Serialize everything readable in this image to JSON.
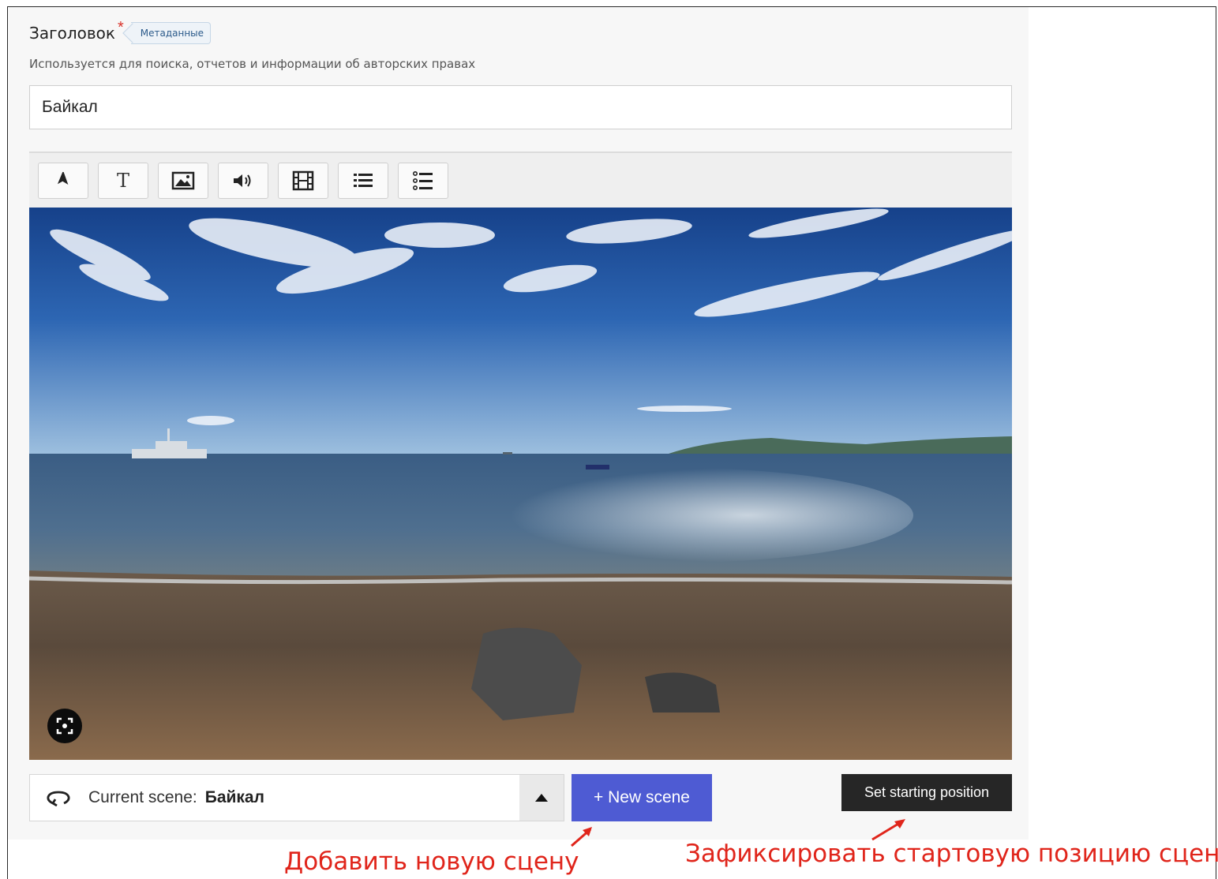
{
  "title_field": {
    "label": "Заголовок",
    "required_mark": "*",
    "badge": "Метаданные",
    "hint": "Используется для поиска, отчетов и информации об авторских правах",
    "value": "Байкал"
  },
  "toolbar": {
    "buttons": [
      {
        "name": "navigation-arrow-icon"
      },
      {
        "name": "text-icon",
        "glyph": "T"
      },
      {
        "name": "image-icon"
      },
      {
        "name": "audio-icon"
      },
      {
        "name": "video-icon"
      },
      {
        "name": "list-icon"
      },
      {
        "name": "numbered-list-icon"
      }
    ]
  },
  "scene_bar": {
    "label": "Current scene:",
    "current": "Байкал",
    "new_scene_button": "+ New scene",
    "set_start_button": "Set starting position"
  },
  "annotations": {
    "add_scene": "Добавить новую сцену",
    "fix_start": "Зафиксировать стартовую позицию сцены"
  },
  "colors": {
    "primary_button": "#4e5bd3",
    "dark_button": "#262626",
    "annotation": "#e0251b",
    "required": "#d9342b"
  }
}
